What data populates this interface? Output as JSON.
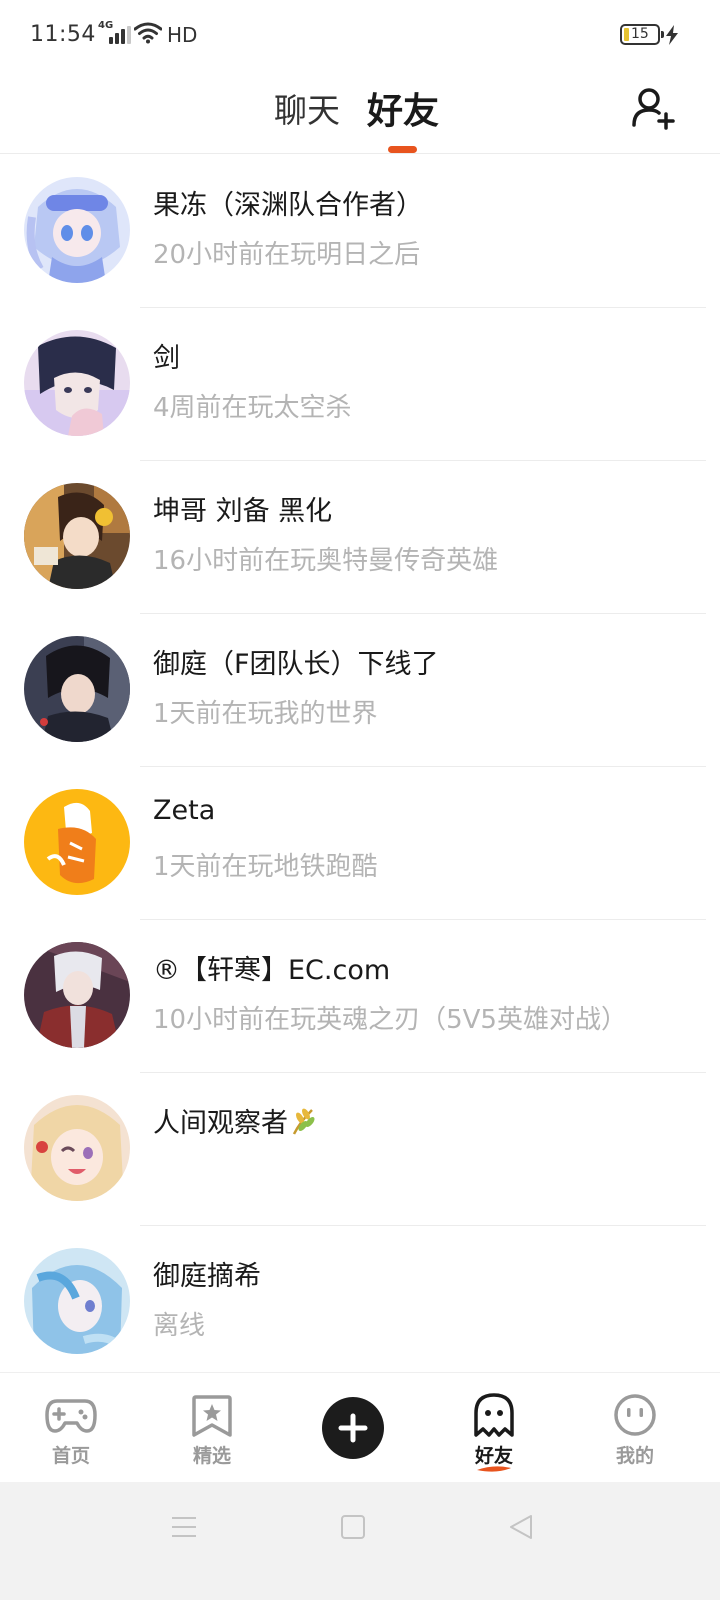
{
  "status_bar": {
    "time": "11:54",
    "network": "4G",
    "hd_label": "HD",
    "battery_level": "15",
    "charging": true
  },
  "header": {
    "tabs": [
      {
        "label": "聊天",
        "active": false
      },
      {
        "label": "好友",
        "active": true
      }
    ],
    "accent_color": "#e8541e",
    "add_friend_icon": "add-user-icon"
  },
  "friends": [
    {
      "name": "果冻（深渊队合作者）",
      "status": "20小时前在玩明日之后"
    },
    {
      "name": "剑",
      "status": "4周前在玩太空杀"
    },
    {
      "name": "坤哥  刘备 黑化",
      "status": "16小时前在玩奥特曼传奇英雄"
    },
    {
      "name": "御庭（F团队长）下线了",
      "status": "1天前在玩我的世界"
    },
    {
      "name": "Zeta",
      "status": "1天前在玩地铁跑酷"
    },
    {
      "name": "®【轩寒】EC.com",
      "status": "10小时前在玩英魂之刃（5V5英雄对战）"
    },
    {
      "name": "人间观察者",
      "status": "",
      "badge_icon": "wheat-icon"
    },
    {
      "name": "御庭摘希",
      "status": "离线"
    }
  ],
  "bottom_nav": {
    "items": [
      {
        "label": "首页",
        "icon": "gamepad-icon"
      },
      {
        "label": "精选",
        "icon": "star-bookmark-icon"
      },
      {
        "label": "",
        "icon": "plus-icon"
      },
      {
        "label": "好友",
        "icon": "ghost-icon",
        "active": true
      },
      {
        "label": "我的",
        "icon": "smiley-icon"
      }
    ]
  },
  "system_nav": {
    "buttons": [
      "menu-icon",
      "home-square-icon",
      "back-triangle-icon"
    ]
  }
}
